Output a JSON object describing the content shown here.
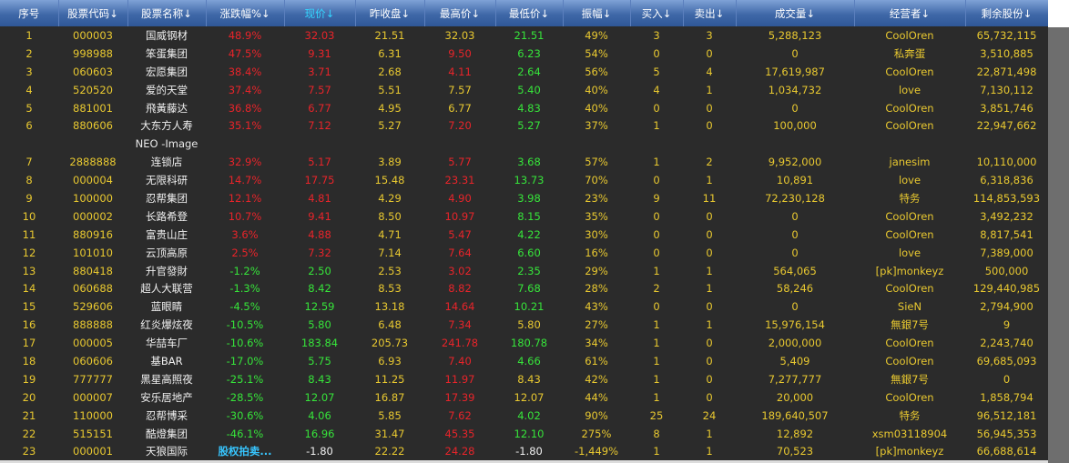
{
  "headers": [
    {
      "label": "序号"
    },
    {
      "label": "股票代码↓"
    },
    {
      "label": "股票名称↓"
    },
    {
      "label": "涨跌幅%↓"
    },
    {
      "label": "现价↓"
    },
    {
      "label": "昨收盘↓"
    },
    {
      "label": "最高价↓"
    },
    {
      "label": "最低价↓"
    },
    {
      "label": "振幅↓"
    },
    {
      "label": "买入↓"
    },
    {
      "label": "卖出↓"
    },
    {
      "label": "成交量↓"
    },
    {
      "label": "经营者↓"
    },
    {
      "label": "剩余股份↓"
    }
  ],
  "rows": [
    {
      "no": "1",
      "code": "000003",
      "name": "国威钢材",
      "chg": "48.9%",
      "price": "32.03",
      "prev": "21.51",
      "high": "32.03",
      "low": "21.51",
      "amp": "49%",
      "buy": "3",
      "sell": "3",
      "vol": "5,288,123",
      "owner": "CoolOren",
      "shares": "65,732,115",
      "pc": "red",
      "hc": "yel",
      "lc": "grn"
    },
    {
      "no": "2",
      "code": "998988",
      "name": "笨蛋集团",
      "chg": "47.5%",
      "price": "9.31",
      "prev": "6.31",
      "high": "9.50",
      "low": "6.23",
      "amp": "54%",
      "buy": "0",
      "sell": "0",
      "vol": "0",
      "owner": "私奔蛋",
      "shares": "3,510,885",
      "pc": "red",
      "hc": "red",
      "lc": "grn"
    },
    {
      "no": "3",
      "code": "060603",
      "name": "宏愿集团",
      "chg": "38.4%",
      "price": "3.71",
      "prev": "2.68",
      "high": "4.11",
      "low": "2.64",
      "amp": "56%",
      "buy": "5",
      "sell": "4",
      "vol": "17,619,987",
      "owner": "CoolOren",
      "shares": "22,871,498",
      "pc": "red",
      "hc": "red",
      "lc": "grn"
    },
    {
      "no": "4",
      "code": "520520",
      "name": "爱的天堂",
      "chg": "37.4%",
      "price": "7.57",
      "prev": "5.51",
      "high": "7.57",
      "low": "5.40",
      "amp": "40%",
      "buy": "4",
      "sell": "1",
      "vol": "1,034,732",
      "owner": "love",
      "shares": "7,130,112",
      "pc": "red",
      "hc": "yel",
      "lc": "grn"
    },
    {
      "no": "5",
      "code": "881001",
      "name": "飛黃藤达",
      "chg": "36.8%",
      "price": "6.77",
      "prev": "4.95",
      "high": "6.77",
      "low": "4.83",
      "amp": "40%",
      "buy": "0",
      "sell": "0",
      "vol": "0",
      "owner": "CoolOren",
      "shares": "3,851,746",
      "pc": "red",
      "hc": "yel",
      "lc": "grn"
    },
    {
      "no": "6",
      "code": "880606",
      "name": "大东方人寿",
      "chg": "35.1%",
      "price": "7.12",
      "prev": "5.27",
      "high": "7.20",
      "low": "5.27",
      "amp": "37%",
      "buy": "1",
      "sell": "0",
      "vol": "100,000",
      "owner": "CoolOren",
      "shares": "22,947,662",
      "pc": "red",
      "hc": "red",
      "lc": "grn"
    },
    {
      "sub": "NEO -Image"
    },
    {
      "no": "7",
      "code": "2888888",
      "name": "连锁店",
      "chg": "32.9%",
      "price": "5.17",
      "prev": "3.89",
      "high": "5.77",
      "low": "3.68",
      "amp": "57%",
      "buy": "1",
      "sell": "2",
      "vol": "9,952,000",
      "owner": "janesim",
      "shares": "10,110,000",
      "pc": "red",
      "hc": "red",
      "lc": "grn"
    },
    {
      "no": "8",
      "code": "000004",
      "name": "无限科研",
      "chg": "14.7%",
      "price": "17.75",
      "prev": "15.48",
      "high": "23.31",
      "low": "13.73",
      "amp": "70%",
      "buy": "0",
      "sell": "1",
      "vol": "10,891",
      "owner": "love",
      "shares": "6,318,836",
      "pc": "red",
      "hc": "red",
      "lc": "grn"
    },
    {
      "no": "9",
      "code": "100000",
      "name": "忍帮集团",
      "chg": "12.1%",
      "price": "4.81",
      "prev": "4.29",
      "high": "4.90",
      "low": "3.98",
      "amp": "23%",
      "buy": "9",
      "sell": "11",
      "vol": "72,230,128",
      "owner": "特务",
      "shares": "114,853,593",
      "pc": "red",
      "hc": "red",
      "lc": "grn"
    },
    {
      "no": "10",
      "code": "000002",
      "name": "长路希登",
      "chg": "10.7%",
      "price": "9.41",
      "prev": "8.50",
      "high": "10.97",
      "low": "8.15",
      "amp": "35%",
      "buy": "0",
      "sell": "0",
      "vol": "0",
      "owner": "CoolOren",
      "shares": "3,492,232",
      "pc": "red",
      "hc": "red",
      "lc": "grn"
    },
    {
      "no": "11",
      "code": "880916",
      "name": "富贵山庄",
      "chg": "3.6%",
      "price": "4.88",
      "prev": "4.71",
      "high": "5.47",
      "low": "4.22",
      "amp": "30%",
      "buy": "0",
      "sell": "0",
      "vol": "0",
      "owner": "CoolOren",
      "shares": "8,817,541",
      "pc": "red",
      "hc": "red",
      "lc": "grn"
    },
    {
      "no": "12",
      "code": "101010",
      "name": "云顶高原",
      "chg": "2.5%",
      "price": "7.32",
      "prev": "7.14",
      "high": "7.64",
      "low": "6.60",
      "amp": "16%",
      "buy": "0",
      "sell": "0",
      "vol": "0",
      "owner": "love",
      "shares": "7,389,000",
      "pc": "red",
      "hc": "red",
      "lc": "grn"
    },
    {
      "no": "13",
      "code": "880418",
      "name": "升官發財",
      "chg": "-1.2%",
      "price": "2.50",
      "prev": "2.53",
      "high": "3.02",
      "low": "2.35",
      "amp": "29%",
      "buy": "1",
      "sell": "1",
      "vol": "564,065",
      "owner": "[pk]monkeyz",
      "shares": "500,000",
      "pc": "grn",
      "hc": "red",
      "lc": "grn"
    },
    {
      "no": "14",
      "code": "060688",
      "name": "超人大联营",
      "chg": "-1.3%",
      "price": "8.42",
      "prev": "8.53",
      "high": "8.82",
      "low": "7.68",
      "amp": "28%",
      "buy": "2",
      "sell": "1",
      "vol": "58,246",
      "owner": "CoolOren",
      "shares": "129,440,985",
      "pc": "grn",
      "hc": "red",
      "lc": "grn"
    },
    {
      "no": "15",
      "code": "529606",
      "name": "蓝眼睛",
      "chg": "-4.5%",
      "price": "12.59",
      "prev": "13.18",
      "high": "14.64",
      "low": "10.21",
      "amp": "43%",
      "buy": "0",
      "sell": "0",
      "vol": "0",
      "owner": "SieN",
      "shares": "2,794,900",
      "pc": "grn",
      "hc": "red",
      "lc": "grn"
    },
    {
      "no": "16",
      "code": "888888",
      "name": "红炎爆炫夜",
      "chg": "-10.5%",
      "price": "5.80",
      "prev": "6.48",
      "high": "7.34",
      "low": "5.80",
      "amp": "27%",
      "buy": "1",
      "sell": "1",
      "vol": "15,976,154",
      "owner": "無銀7号",
      "shares": "9",
      "pc": "grn",
      "hc": "red",
      "lc": "yel"
    },
    {
      "no": "17",
      "code": "000005",
      "name": "华喆车厂",
      "chg": "-10.6%",
      "price": "183.84",
      "prev": "205.73",
      "high": "241.78",
      "low": "180.78",
      "amp": "34%",
      "buy": "1",
      "sell": "0",
      "vol": "2,000,000",
      "owner": "CoolOren",
      "shares": "2,243,740",
      "pc": "grn",
      "hc": "red",
      "lc": "grn"
    },
    {
      "no": "18",
      "code": "060606",
      "name": "基BAR",
      "chg": "-17.0%",
      "price": "5.75",
      "prev": "6.93",
      "high": "7.40",
      "low": "4.66",
      "amp": "61%",
      "buy": "1",
      "sell": "0",
      "vol": "5,409",
      "owner": "CoolOren",
      "shares": "69,685,093",
      "pc": "grn",
      "hc": "red",
      "lc": "grn"
    },
    {
      "no": "19",
      "code": "777777",
      "name": "黑星高照夜",
      "chg": "-25.1%",
      "price": "8.43",
      "prev": "11.25",
      "high": "11.97",
      "low": "8.43",
      "amp": "42%",
      "buy": "1",
      "sell": "0",
      "vol": "7,277,777",
      "owner": "無銀7号",
      "shares": "0",
      "pc": "grn",
      "hc": "red",
      "lc": "yel"
    },
    {
      "no": "20",
      "code": "000007",
      "name": "安乐居地产",
      "chg": "-28.5%",
      "price": "12.07",
      "prev": "16.87",
      "high": "17.39",
      "low": "12.07",
      "amp": "44%",
      "buy": "1",
      "sell": "0",
      "vol": "20,000",
      "owner": "CoolOren",
      "shares": "1,858,794",
      "pc": "grn",
      "hc": "red",
      "lc": "yel"
    },
    {
      "no": "21",
      "code": "110000",
      "name": "忍帮博采",
      "chg": "-30.6%",
      "price": "4.06",
      "prev": "5.85",
      "high": "7.62",
      "low": "4.02",
      "amp": "90%",
      "buy": "25",
      "sell": "24",
      "vol": "189,640,507",
      "owner": "特务",
      "shares": "96,512,181",
      "pc": "grn",
      "hc": "red",
      "lc": "grn"
    },
    {
      "no": "22",
      "code": "515151",
      "name": "酷燈集团",
      "chg": "-46.1%",
      "price": "16.96",
      "prev": "31.47",
      "high": "45.35",
      "low": "12.10",
      "amp": "275%",
      "buy": "8",
      "sell": "1",
      "vol": "12,892",
      "owner": "xsm03118904",
      "shares": "56,945,353",
      "pc": "grn",
      "hc": "red",
      "lc": "grn"
    },
    {
      "no": "23",
      "code": "000001",
      "name": "天狼国际",
      "chg": "股权拍卖...",
      "price": "-1.80",
      "prev": "22.22",
      "high": "24.28",
      "low": "-1.80",
      "amp": "-1,449%",
      "buy": "1",
      "sell": "1",
      "vol": "70,523",
      "owner": "[pk]monkeyz",
      "shares": "66,688,614",
      "pc": "wht",
      "hc": "red",
      "lc": "wht",
      "chgc": "cyan"
    }
  ],
  "colors": {
    "header_top": "#7fa2d6",
    "header_bottom": "#2f5797",
    "panel": "#2b2b2b",
    "up": "#e8242a",
    "down": "#36e43a",
    "text": "#e8c830",
    "active_header": "#34d6ff"
  }
}
